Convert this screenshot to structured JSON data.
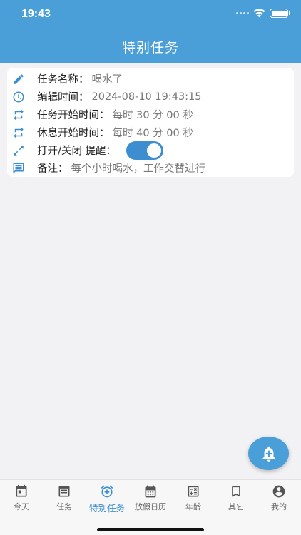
{
  "status": {
    "time": "19:43"
  },
  "header": {
    "title": "特别任务"
  },
  "task": {
    "name_label": "任务名称：",
    "name_value": "喝水了",
    "edit_label": "编辑时间：",
    "edit_value": "2024-08-10 19:43:15",
    "start_label": "任务开始时间：",
    "start_value": "每时 30 分 00 秒",
    "rest_label": "休息开始时间：",
    "rest_value": "每时 40 分 00 秒",
    "toggle_label": "打开/关闭 提醒：",
    "toggle_on": true,
    "note_label": "备注：",
    "note_value": "每个小时喝水，工作交替进行"
  },
  "tabs": [
    {
      "label": "今天",
      "icon": "calendar-today-icon"
    },
    {
      "label": "任务",
      "icon": "task-list-icon"
    },
    {
      "label": "特别任务",
      "icon": "alarm-add-icon",
      "active": true
    },
    {
      "label": "放假日历",
      "icon": "calendar-grid-icon"
    },
    {
      "label": "年龄",
      "icon": "calculator-icon"
    },
    {
      "label": "其它",
      "icon": "bookmark-icon"
    },
    {
      "label": "我的",
      "icon": "account-icon"
    }
  ],
  "colors": {
    "primary": "#4a9fd8",
    "accent": "#3c8ed1"
  }
}
